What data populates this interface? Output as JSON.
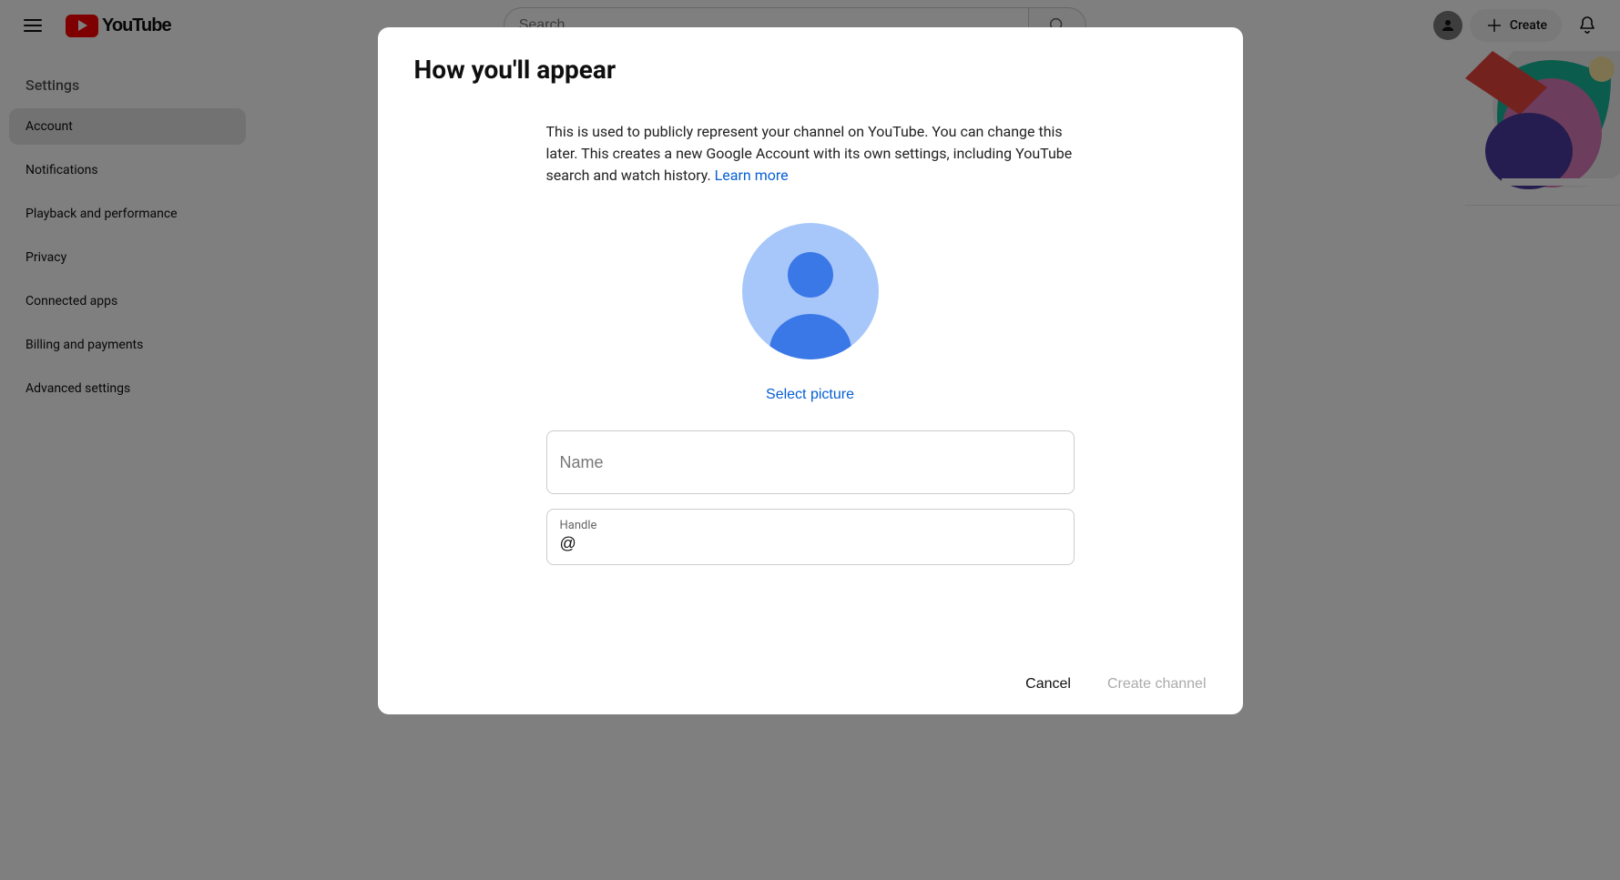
{
  "topbar": {
    "brand": "YouTube",
    "search_placeholder": "Search",
    "create_label": "Create"
  },
  "sidebar": {
    "title": "Settings",
    "items": [
      {
        "label": "Account",
        "active": true
      },
      {
        "label": "Notifications",
        "active": false
      },
      {
        "label": "Playback and performance",
        "active": false
      },
      {
        "label": "Privacy",
        "active": false
      },
      {
        "label": "Connected apps",
        "active": false
      },
      {
        "label": "Billing and payments",
        "active": false
      },
      {
        "label": "Advanced settings",
        "active": false
      }
    ]
  },
  "dialog": {
    "title": "How you'll appear",
    "description_part1": "This is used to publicly represent your channel on YouTube. You can change this later. This creates a new Google Account with its own settings, including YouTube search and watch history. ",
    "learn_more": "Learn more",
    "select_picture": "Select picture",
    "name_placeholder": "Name",
    "name_value": "",
    "handle_label": "Handle",
    "handle_value": "@",
    "cancel": "Cancel",
    "create_channel": "Create channel"
  }
}
